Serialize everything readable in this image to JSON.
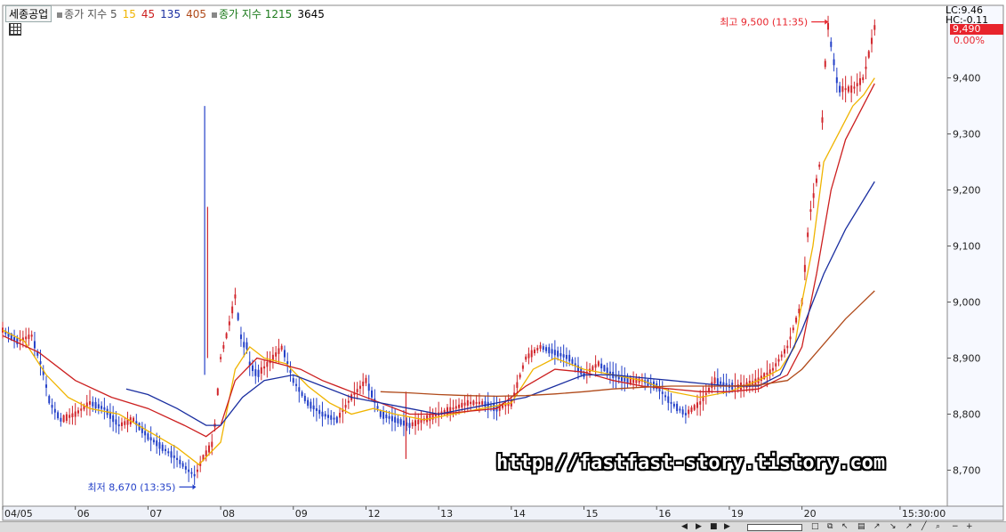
{
  "legend": {
    "stock_name": "세종공업",
    "label_index_a": "종가 지수 5",
    "ma_15": "15",
    "ma_45": "45",
    "ma_135": "135",
    "ma_405": "405",
    "label_index_b": "종가 지수 1215",
    "ma_3645": "3645"
  },
  "right_info": {
    "lc": "LC:9.46",
    "hc": "HC:-0.11",
    "current_price": "9,490",
    "change_pct": "0.00%"
  },
  "annotations": {
    "high_label": "최고 9,500 (11:35)",
    "low_label": "최저 8,670 (13:35)"
  },
  "watermark": "http://fastfast-story.tistory.com",
  "colors": {
    "ma5": "#f0b400",
    "ma15": "#cc1f1f",
    "ma45": "#1a2ea0",
    "ma135": "#b04a1a",
    "ma405": "#8a5a00",
    "candle_up": "#d1262c",
    "candle_down": "#2340c8",
    "accent_red": "#e8242c"
  },
  "chart_data": {
    "type": "line",
    "title": "",
    "xlabel": "",
    "ylabel": "",
    "ylim": [
      8650,
      9520
    ],
    "y_ticks": [
      "9,400",
      "9,300",
      "9,200",
      "9,100",
      "9,000",
      "8,900",
      "8,800",
      "8,700"
    ],
    "y_tick_values": [
      9400,
      9300,
      9200,
      9100,
      9000,
      8900,
      8800,
      8700
    ],
    "x_tick_labels": [
      "04/05",
      "06",
      "07",
      "08",
      "09",
      "12",
      "13",
      "14",
      "15",
      "16",
      "19",
      "20",
      "15:30:00"
    ],
    "x_tick_index": [
      0,
      1,
      2,
      3,
      4,
      5,
      6,
      7,
      8,
      9,
      10,
      11,
      12.35
    ],
    "x_index_range": [
      0,
      13
    ],
    "high": {
      "value": 9500,
      "time": "11:35",
      "x_index": 11.35
    },
    "low": {
      "value": 8670,
      "time": "13:35",
      "x_index": 2.65
    },
    "series": [
      {
        "key": "price",
        "x": [
          0,
          0.2,
          0.4,
          0.55,
          0.65,
          0.8,
          1,
          1.2,
          1.4,
          1.6,
          1.8,
          2,
          2.2,
          2.4,
          2.55,
          2.65,
          2.75,
          2.9,
          3.0,
          3.1,
          3.2,
          3.3,
          3.35,
          3.4,
          3.5,
          3.65,
          3.85,
          4,
          4.2,
          4.4,
          4.6,
          4.8,
          5,
          5.2,
          5.4,
          5.6,
          5.8,
          6,
          6.2,
          6.4,
          6.6,
          6.8,
          7,
          7.2,
          7.4,
          7.6,
          7.8,
          8,
          8.2,
          8.4,
          8.6,
          8.8,
          9,
          9.2,
          9.4,
          9.6,
          9.8,
          10,
          10.2,
          10.4,
          10.6,
          10.8,
          10.9,
          11,
          11.1,
          11.25,
          11.35,
          11.5,
          11.7,
          11.85,
          12
        ],
        "y": [
          8950,
          8930,
          8940,
          8880,
          8820,
          8790,
          8800,
          8820,
          8810,
          8780,
          8790,
          8760,
          8740,
          8720,
          8700,
          8690,
          8720,
          8750,
          8900,
          8950,
          9010,
          8920,
          8930,
          8890,
          8870,
          8890,
          8920,
          8860,
          8820,
          8800,
          8790,
          8830,
          8860,
          8800,
          8790,
          8780,
          8790,
          8800,
          8810,
          8820,
          8820,
          8810,
          8820,
          8900,
          8920,
          8910,
          8900,
          8870,
          8890,
          8870,
          8860,
          8860,
          8850,
          8820,
          8800,
          8820,
          8860,
          8850,
          8850,
          8860,
          8880,
          8920,
          8960,
          9000,
          9150,
          9250,
          9500,
          9380,
          9380,
          9400,
          9490
        ]
      },
      {
        "key": "ma5",
        "x": [
          0,
          0.3,
          0.6,
          0.9,
          1.2,
          1.6,
          2,
          2.4,
          2.7,
          3.0,
          3.2,
          3.4,
          3.6,
          3.9,
          4.2,
          4.5,
          4.8,
          5.1,
          5.4,
          5.8,
          6.2,
          6.6,
          7,
          7.3,
          7.6,
          8,
          8.4,
          8.8,
          9.2,
          9.6,
          10,
          10.4,
          10.7,
          10.9,
          11,
          11.15,
          11.3,
          11.5,
          11.7,
          11.85,
          12
        ],
        "y": [
          8950,
          8930,
          8870,
          8830,
          8810,
          8800,
          8770,
          8740,
          8710,
          8750,
          8880,
          8920,
          8900,
          8890,
          8850,
          8820,
          8800,
          8810,
          8800,
          8790,
          8800,
          8810,
          8820,
          8880,
          8900,
          8880,
          8870,
          8860,
          8840,
          8830,
          8840,
          8860,
          8880,
          8920,
          9000,
          9100,
          9250,
          9300,
          9350,
          9370,
          9400
        ]
      },
      {
        "key": "ma15",
        "x": [
          0,
          0.5,
          1,
          1.5,
          2,
          2.5,
          2.8,
          3.0,
          3.2,
          3.5,
          3.8,
          4.1,
          4.4,
          4.8,
          5.2,
          5.6,
          6,
          6.4,
          6.8,
          7.2,
          7.6,
          8,
          8.4,
          8.8,
          9.2,
          9.6,
          10,
          10.4,
          10.8,
          11,
          11.2,
          11.4,
          11.6,
          11.8,
          12
        ],
        "y": [
          8940,
          8910,
          8860,
          8830,
          8810,
          8780,
          8760,
          8780,
          8860,
          8900,
          8890,
          8880,
          8860,
          8840,
          8820,
          8800,
          8800,
          8805,
          8810,
          8850,
          8880,
          8875,
          8860,
          8850,
          8845,
          8840,
          8840,
          8845,
          8870,
          8920,
          9050,
          9200,
          9290,
          9340,
          9390
        ]
      },
      {
        "key": "ma45",
        "x": [
          1.7,
          2,
          2.4,
          2.8,
          3.0,
          3.3,
          3.6,
          4,
          4.4,
          4.8,
          5.2,
          5.6,
          6,
          6.4,
          6.8,
          7.2,
          7.6,
          8,
          8.4,
          8.8,
          9.2,
          9.6,
          10,
          10.4,
          10.7,
          11,
          11.3,
          11.6,
          12
        ],
        "y": [
          8845,
          8835,
          8810,
          8780,
          8780,
          8830,
          8860,
          8870,
          8850,
          8830,
          8820,
          8810,
          8800,
          8810,
          8820,
          8830,
          8850,
          8870,
          8870,
          8865,
          8860,
          8855,
          8850,
          8850,
          8870,
          8950,
          9050,
          9130,
          9215
        ]
      },
      {
        "key": "ma135",
        "x": [
          5.2,
          5.6,
          6,
          6.4,
          6.8,
          7.2,
          7.6,
          8,
          8.4,
          8.8,
          9.2,
          9.6,
          10,
          10.4,
          10.8,
          11,
          11.2,
          11.4,
          11.6,
          11.8,
          12
        ],
        "y": [
          8840,
          8838,
          8835,
          8833,
          8832,
          8833,
          8836,
          8840,
          8845,
          8848,
          8850,
          8850,
          8850,
          8852,
          8860,
          8880,
          8910,
          8940,
          8970,
          8995,
          9020
        ]
      }
    ]
  },
  "toolbar": {
    "zoom_in": "+",
    "zoom_out": "−"
  }
}
